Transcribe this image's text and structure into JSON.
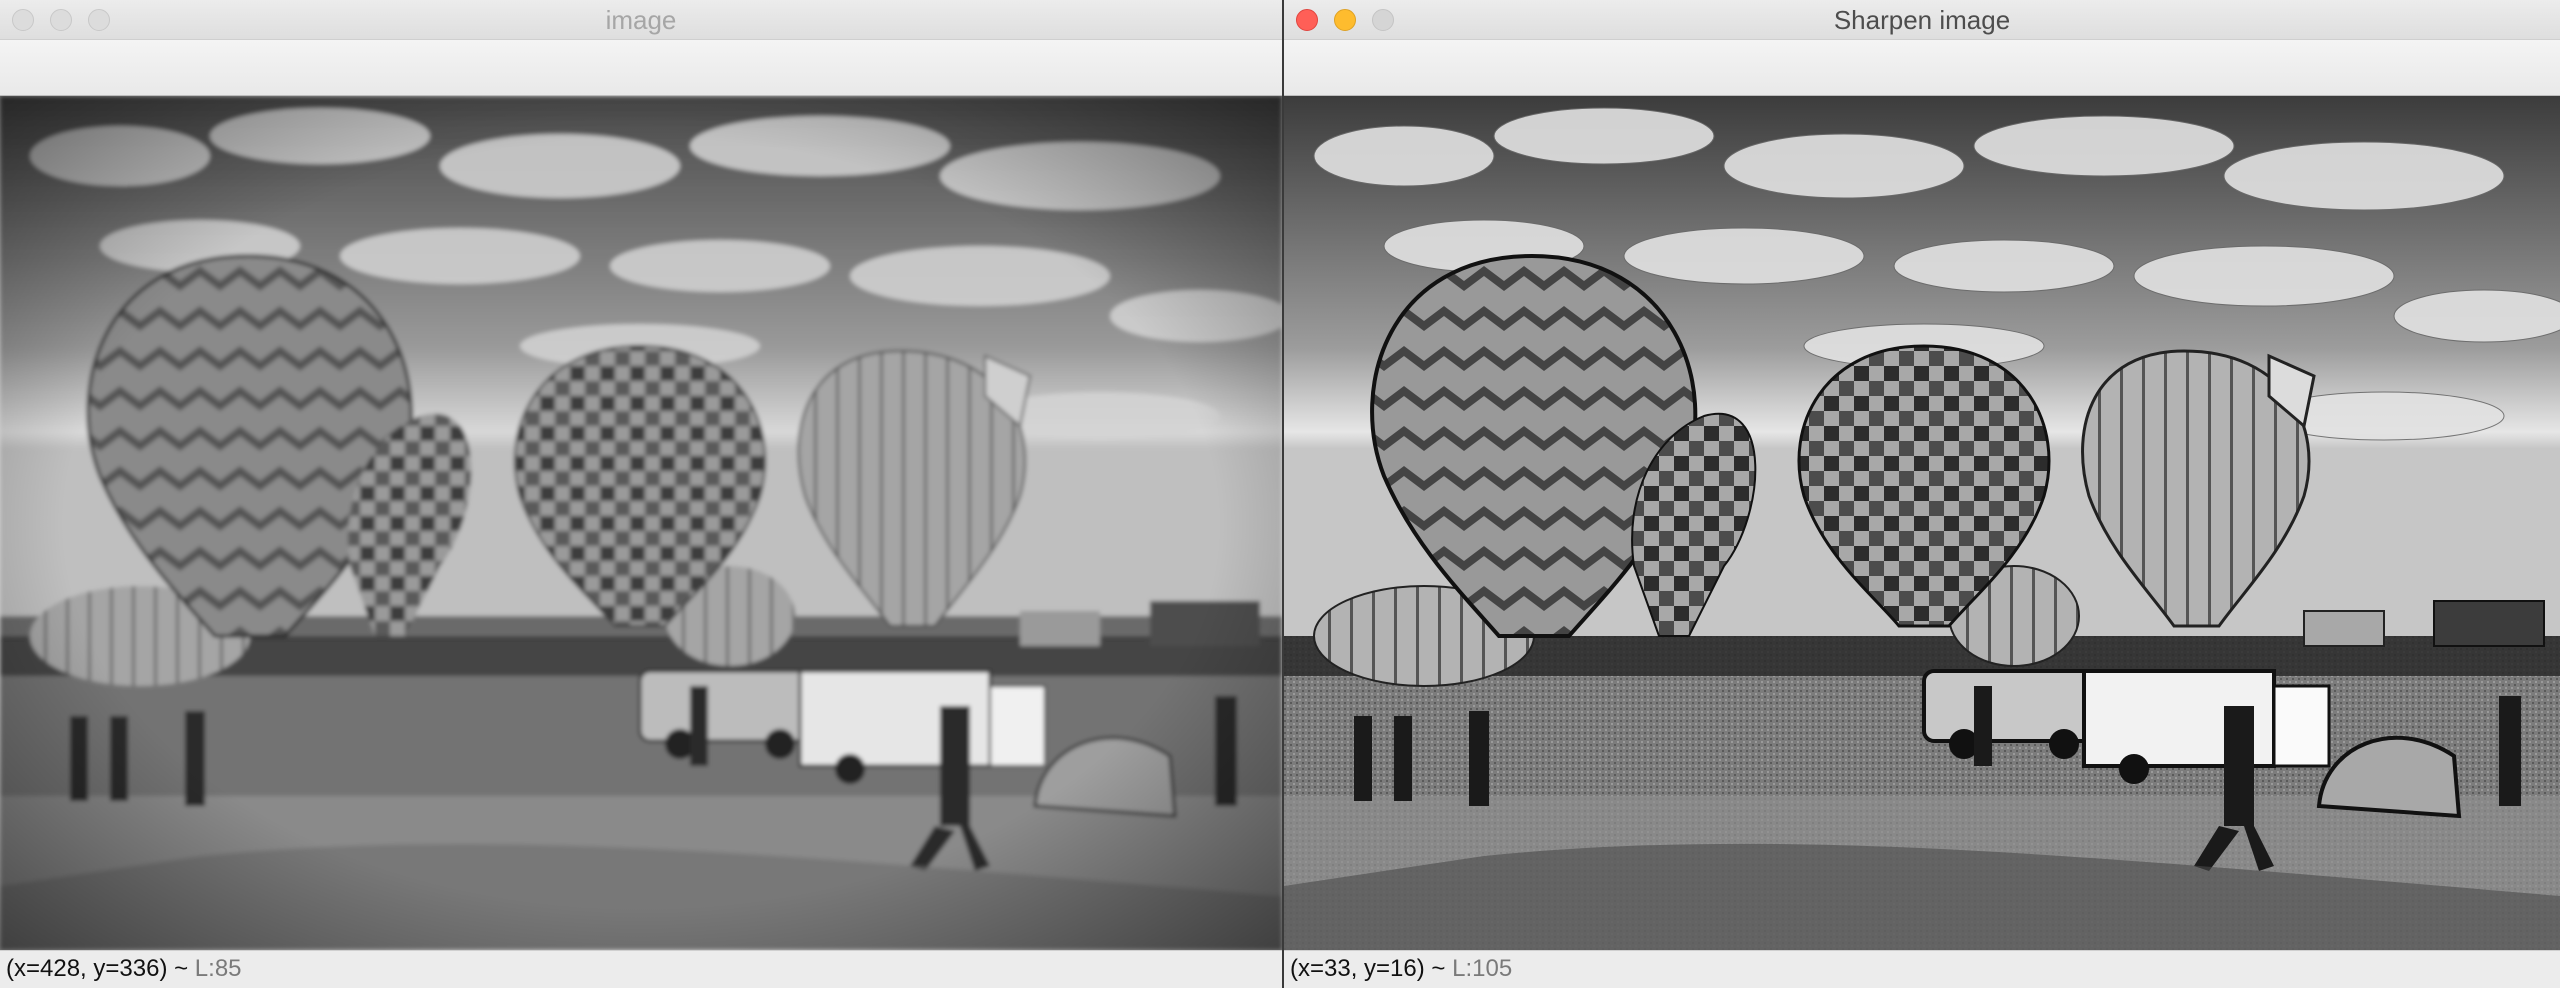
{
  "windows": [
    {
      "title": "image",
      "status_coords": "(x=428, y=336) ~",
      "status_lum": "L:85"
    },
    {
      "title": "Sharpen image",
      "status_coords": "(x=33, y=16) ~",
      "status_lum": "L:105"
    }
  ],
  "icons": {
    "traffic_lights_left": [
      "close-icon-inactive",
      "minimize-icon-inactive",
      "zoom-icon-inactive"
    ],
    "traffic_lights_right": [
      "close-icon",
      "minimize-icon",
      "zoom-icon-disabled"
    ]
  },
  "colors": {
    "close": "#ff5f57",
    "minimize": "#febc2e",
    "titlebar": "#ececec"
  }
}
